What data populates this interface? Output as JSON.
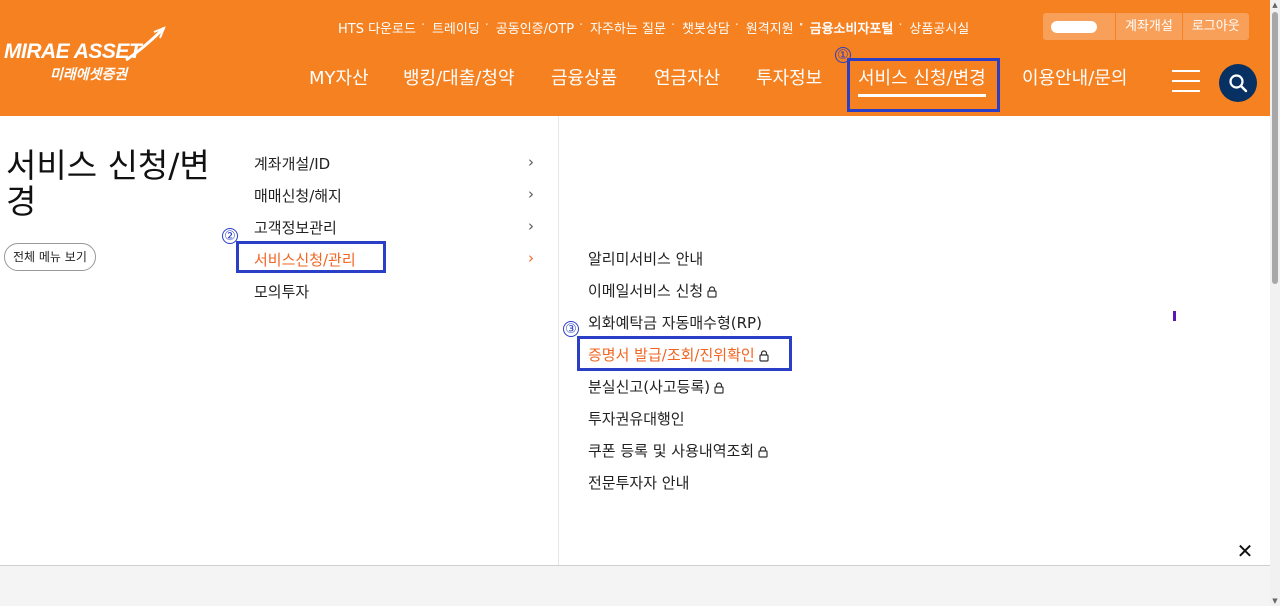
{
  "logo": {
    "line1": "MIRAE ASSET",
    "line2": "미래에셋증권"
  },
  "utility_links": [
    "HTS 다운로드",
    "트레이딩",
    "공동인증/OTP",
    "자주하는 질문",
    "챗봇상담",
    "원격지원",
    "금융소비자포털",
    "상품공시실"
  ],
  "utility_buttons": {
    "open_account": "계좌개설",
    "logout": "로그아웃"
  },
  "gnb": [
    "MY자산",
    "뱅킹/대출/청약",
    "금융상품",
    "연금자산",
    "투자정보",
    "서비스 신청/변경",
    "이용안내/문의"
  ],
  "annotations": [
    "①",
    "②",
    "③"
  ],
  "page_title": "서비스 신청/변경",
  "all_menu_button": "전체 메뉴 보기",
  "lnb": [
    "계좌개설/ID",
    "매매신청/해지",
    "고객정보관리",
    "서비스신청/관리",
    "모의투자"
  ],
  "lnb_chevron": "›",
  "submenu": [
    "알리미서비스 안내",
    "이메일서비스 신청",
    "외화예탁금 자동매수형(RP)",
    "증명서 발급/조회/진위확인",
    "분실신고(사고등록)",
    "투자권유대행인",
    "쿠폰 등록 및 사용내역조회",
    "전문투자자 안내"
  ],
  "close_label": "✕",
  "colors": {
    "header_bg": "#f58120",
    "accent": "#f26522",
    "annotation": "#2b3ec6",
    "search_bg": "#083163"
  }
}
